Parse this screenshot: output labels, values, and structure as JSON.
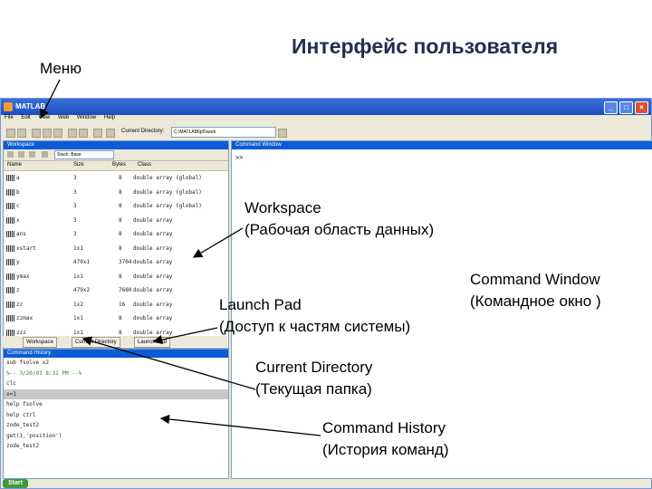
{
  "slide": {
    "title": "Интерфейс пользователя",
    "menu_label": "Меню"
  },
  "annotations": {
    "workspace": [
      "Workspace",
      "(Рабочая область данных)"
    ],
    "command_window": [
      "Command Window",
      "(Командное окно )"
    ],
    "launch_pad": [
      "Launch Pad",
      "(Доступ к частям системы)"
    ],
    "current_directory": [
      "Current Directory",
      "(Текущая папка)"
    ],
    "command_history": [
      "Command History",
      "(История команд)"
    ]
  },
  "matlab": {
    "title": "MATLAB",
    "window_buttons": [
      "_",
      "□",
      "×"
    ],
    "menu": [
      "File",
      "Edit",
      "View",
      "Web",
      "Window",
      "Help"
    ],
    "current_directory_label": "Current Directory:",
    "current_directory_value": "C:\\MATLAB6p5\\work",
    "workspace": {
      "header": "Workspace",
      "stack_label": "Stack: Base",
      "columns": [
        "Name",
        "Size",
        "Bytes",
        "Class"
      ],
      "rows": [
        {
          "name": "a",
          "size": "3",
          "bytes": "8",
          "class": "double array (global)"
        },
        {
          "name": "b",
          "size": "3",
          "bytes": "8",
          "class": "double array (global)"
        },
        {
          "name": "c",
          "size": "3",
          "bytes": "8",
          "class": "double array (global)"
        },
        {
          "name": "x",
          "size": "3",
          "bytes": "8",
          "class": "double array"
        },
        {
          "name": "ans",
          "size": "3",
          "bytes": "8",
          "class": "double array"
        },
        {
          "name": "xstart",
          "size": "1x1",
          "bytes": "8",
          "class": "double array"
        },
        {
          "name": "y",
          "size": "479x1",
          "bytes": "3704",
          "class": "double array"
        },
        {
          "name": "ymax",
          "size": "1x1",
          "bytes": "8",
          "class": "double array"
        },
        {
          "name": "z",
          "size": "479x2",
          "bytes": "7680",
          "class": "double array"
        },
        {
          "name": "zz",
          "size": "1x2",
          "bytes": "16",
          "class": "double array"
        },
        {
          "name": "zzmax",
          "size": "1x1",
          "bytes": "8",
          "class": "double array"
        },
        {
          "name": "zzz",
          "size": "1x1",
          "bytes": "8",
          "class": "double array"
        }
      ]
    },
    "tabs": [
      "Workspace",
      "Current Directory",
      "Launch Pad"
    ],
    "command_history": {
      "header": "Command History",
      "lines": [
        {
          "text": "sub fsolve x2",
          "kind": "normal"
        },
        {
          "text": "%-- 3/20/03 8:31 PM --%",
          "kind": "session"
        },
        {
          "text": "clc",
          "kind": "normal"
        },
        {
          "text": "x=1",
          "kind": "highlight"
        },
        {
          "text": "help fsolve",
          "kind": "normal"
        },
        {
          "text": "help ctrl",
          "kind": "normal"
        },
        {
          "text": "zode_test2",
          "kind": "normal"
        },
        {
          "text": "get(1,'position')",
          "kind": "normal"
        },
        {
          "text": "zode_test2",
          "kind": "normal"
        }
      ]
    },
    "command_window": {
      "header": "Command Window",
      "prompt": ">>"
    },
    "start_button": "Start"
  }
}
